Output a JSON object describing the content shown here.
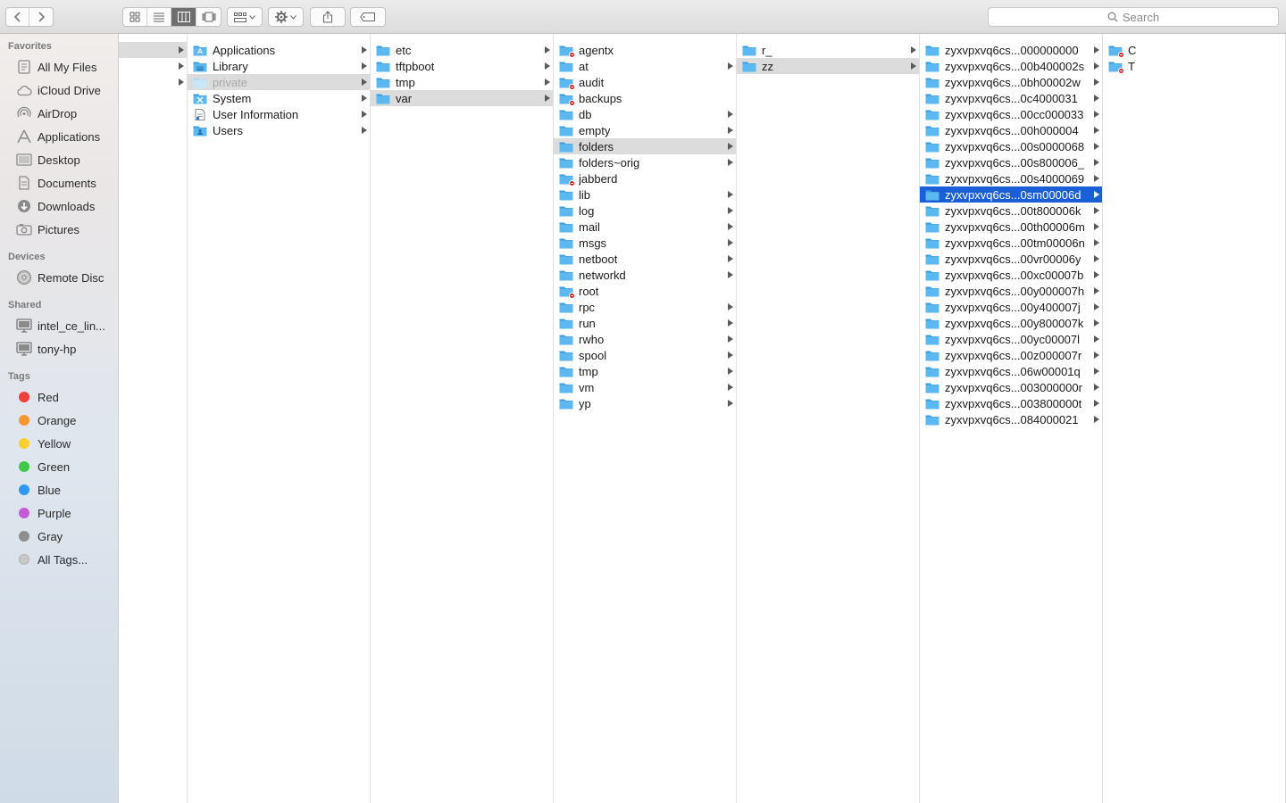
{
  "toolbar": {
    "back_icon": "chevron-left-icon",
    "forward_icon": "chevron-right-icon",
    "search_placeholder": "Search"
  },
  "sidebar": {
    "favorites_header": "Favorites",
    "favorites": [
      {
        "label": "All My Files",
        "icon": "all-files-icon"
      },
      {
        "label": "iCloud Drive",
        "icon": "cloud-icon"
      },
      {
        "label": "AirDrop",
        "icon": "airdrop-icon"
      },
      {
        "label": "Applications",
        "icon": "applications-icon"
      },
      {
        "label": "Desktop",
        "icon": "desktop-icon"
      },
      {
        "label": "Documents",
        "icon": "documents-icon"
      },
      {
        "label": "Downloads",
        "icon": "downloads-icon"
      },
      {
        "label": "Pictures",
        "icon": "pictures-icon"
      }
    ],
    "devices_header": "Devices",
    "devices": [
      {
        "label": "Remote Disc",
        "icon": "disc-icon"
      }
    ],
    "shared_header": "Shared",
    "shared": [
      {
        "label": "intel_ce_lin...",
        "icon": "monitor-icon"
      },
      {
        "label": "tony-hp",
        "icon": "monitor-icon"
      }
    ],
    "tags_header": "Tags",
    "tags": [
      {
        "label": "Red",
        "color": "#f0403a"
      },
      {
        "label": "Orange",
        "color": "#f7962e"
      },
      {
        "label": "Yellow",
        "color": "#f7cf2f"
      },
      {
        "label": "Green",
        "color": "#3ec946"
      },
      {
        "label": "Blue",
        "color": "#2f98f3"
      },
      {
        "label": "Purple",
        "color": "#c65bd6"
      },
      {
        "label": "Gray",
        "color": "#8e8e8e"
      },
      {
        "label": "All Tags...",
        "color": "#c8c8c8"
      }
    ]
  },
  "columns": [
    {
      "id": "root",
      "items": [
        {
          "label": "",
          "chevron": true,
          "sel": "gray"
        },
        {
          "label": "",
          "chevron": true
        },
        {
          "label": "",
          "chevron": true
        }
      ]
    },
    {
      "id": "disk",
      "items": [
        {
          "label": "Applications",
          "chevron": true,
          "icon": "app-folder"
        },
        {
          "label": "Library",
          "chevron": true,
          "icon": "lib-folder"
        },
        {
          "label": "private",
          "chevron": true,
          "sel": "gray",
          "dim": true,
          "icon": "folder-light"
        },
        {
          "label": "System",
          "chevron": true,
          "icon": "sys-folder"
        },
        {
          "label": "User Information",
          "chevron": true,
          "icon": "doc"
        },
        {
          "label": "Users",
          "chevron": true,
          "icon": "users-folder"
        }
      ]
    },
    {
      "id": "private",
      "items": [
        {
          "label": "etc",
          "chevron": true
        },
        {
          "label": "tftpboot",
          "chevron": true
        },
        {
          "label": "tmp",
          "chevron": true
        },
        {
          "label": "var",
          "chevron": true,
          "sel": "gray"
        }
      ]
    },
    {
      "id": "var",
      "items": [
        {
          "label": "agentx",
          "chevron": false,
          "lock": true
        },
        {
          "label": "at",
          "chevron": true
        },
        {
          "label": "audit",
          "chevron": false,
          "lock": true
        },
        {
          "label": "backups",
          "chevron": false,
          "lock": true
        },
        {
          "label": "db",
          "chevron": true
        },
        {
          "label": "empty",
          "chevron": true
        },
        {
          "label": "folders",
          "chevron": true,
          "sel": "gray"
        },
        {
          "label": "folders~orig",
          "chevron": true
        },
        {
          "label": "jabberd",
          "chevron": false,
          "lock": true
        },
        {
          "label": "lib",
          "chevron": true
        },
        {
          "label": "log",
          "chevron": true
        },
        {
          "label": "mail",
          "chevron": true
        },
        {
          "label": "msgs",
          "chevron": true
        },
        {
          "label": "netboot",
          "chevron": true
        },
        {
          "label": "networkd",
          "chevron": true
        },
        {
          "label": "root",
          "chevron": false,
          "lock": true
        },
        {
          "label": "rpc",
          "chevron": true
        },
        {
          "label": "run",
          "chevron": true
        },
        {
          "label": "rwho",
          "chevron": true
        },
        {
          "label": "spool",
          "chevron": true
        },
        {
          "label": "tmp",
          "chevron": true
        },
        {
          "label": "vm",
          "chevron": true
        },
        {
          "label": "yp",
          "chevron": true
        }
      ]
    },
    {
      "id": "folders",
      "items": [
        {
          "label": "r_",
          "chevron": true
        },
        {
          "label": "zz",
          "chevron": true,
          "sel": "gray"
        }
      ]
    },
    {
      "id": "zz",
      "items": [
        {
          "label": "zyxvpxvq6cs...000000000",
          "chevron": true
        },
        {
          "label": "zyxvpxvq6cs...00b400002s",
          "chevron": true
        },
        {
          "label": "zyxvpxvq6cs...0bh00002w",
          "chevron": true
        },
        {
          "label": "zyxvpxvq6cs...0c4000031",
          "chevron": true
        },
        {
          "label": "zyxvpxvq6cs...00cc000033",
          "chevron": true
        },
        {
          "label": "zyxvpxvq6cs...00h000004",
          "chevron": true
        },
        {
          "label": "zyxvpxvq6cs...00s0000068",
          "chevron": true
        },
        {
          "label": "zyxvpxvq6cs...00s800006_",
          "chevron": true
        },
        {
          "label": "zyxvpxvq6cs...00s4000069",
          "chevron": true
        },
        {
          "label": "zyxvpxvq6cs...0sm00006d",
          "chevron": true,
          "sel": "blue"
        },
        {
          "label": "zyxvpxvq6cs...00t800006k",
          "chevron": true
        },
        {
          "label": "zyxvpxvq6cs...00th00006m",
          "chevron": true
        },
        {
          "label": "zyxvpxvq6cs...00tm00006n",
          "chevron": true
        },
        {
          "label": "zyxvpxvq6cs...00vr00006y",
          "chevron": true
        },
        {
          "label": "zyxvpxvq6cs...00xc00007b",
          "chevron": true
        },
        {
          "label": "zyxvpxvq6cs...00y000007h",
          "chevron": true
        },
        {
          "label": "zyxvpxvq6cs...00y400007j",
          "chevron": true
        },
        {
          "label": "zyxvpxvq6cs...00y800007k",
          "chevron": true
        },
        {
          "label": "zyxvpxvq6cs...00yc00007l",
          "chevron": true
        },
        {
          "label": "zyxvpxvq6cs...00z000007r",
          "chevron": true
        },
        {
          "label": "zyxvpxvq6cs...06w00001q",
          "chevron": true
        },
        {
          "label": "zyxvpxvq6cs...003000000r",
          "chevron": true
        },
        {
          "label": "zyxvpxvq6cs...003800000t",
          "chevron": true
        },
        {
          "label": "zyxvpxvq6cs...084000021",
          "chevron": true
        }
      ]
    },
    {
      "id": "selected",
      "items": [
        {
          "label": "C",
          "chevron": false,
          "lock": true
        },
        {
          "label": "T",
          "chevron": false,
          "lock": true
        }
      ]
    }
  ],
  "colors": {
    "folder": "#5cb8f0",
    "selection_blue": "#1b5fd8",
    "selection_gray": "#dcdcdc"
  }
}
